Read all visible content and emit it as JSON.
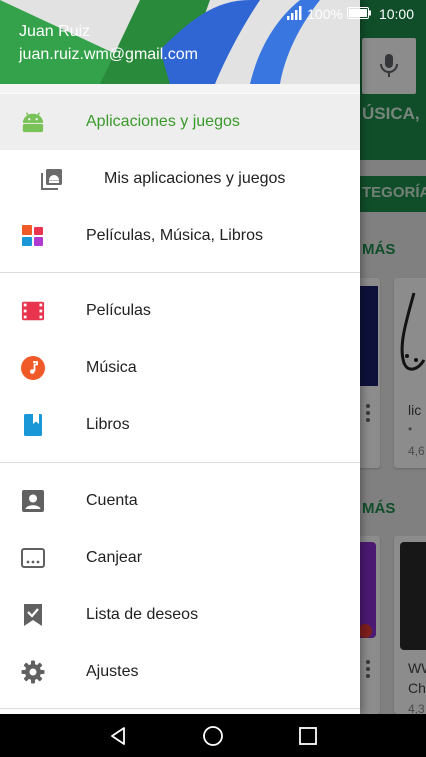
{
  "status_bar": {
    "battery_percent": "100%",
    "time": "10:00"
  },
  "account": {
    "name": "Juan Ruiz",
    "email": "juan.ruiz.wm@gmail.com"
  },
  "menu": {
    "apps_games": "Aplicaciones y juegos",
    "my_apps": "Mis aplicaciones y juegos",
    "movies_music_books": "Películas, Música, Libros",
    "movies": "Películas",
    "music": "Música",
    "books": "Libros",
    "account": "Cuenta",
    "redeem": "Canjear",
    "wishlist": "Lista de deseos",
    "settings": "Ajustes"
  },
  "background": {
    "tab_fragment": "ÚSICA,",
    "categories_fragment": "TEGORÍA",
    "more_1": "MÁS",
    "more_2": "MÁS",
    "card_1_title": "lic",
    "card_1_dot": "•",
    "card_1_rating": "4,6",
    "card_2_title_1": "WW",
    "card_2_title_2": "Ch",
    "card_2_rating": "4,3"
  },
  "colors": {
    "accent_green": "#3a9a2a",
    "play_green": "#1e8e4e",
    "header_blue": "#2f66d3",
    "movies_red": "#e8344e",
    "music_orange": "#f05a28",
    "books_blue": "#1a97d6"
  },
  "icons": {
    "apps_games": "android-icon",
    "my_apps": "library-icon",
    "movies_music_books": "entertainment-grid-icon",
    "movies": "film-icon",
    "music": "music-note-icon",
    "books": "bookmark-book-icon",
    "account": "account-box-icon",
    "redeem": "redeem-card-icon",
    "wishlist": "bookmark-check-icon",
    "settings": "gear-icon"
  }
}
